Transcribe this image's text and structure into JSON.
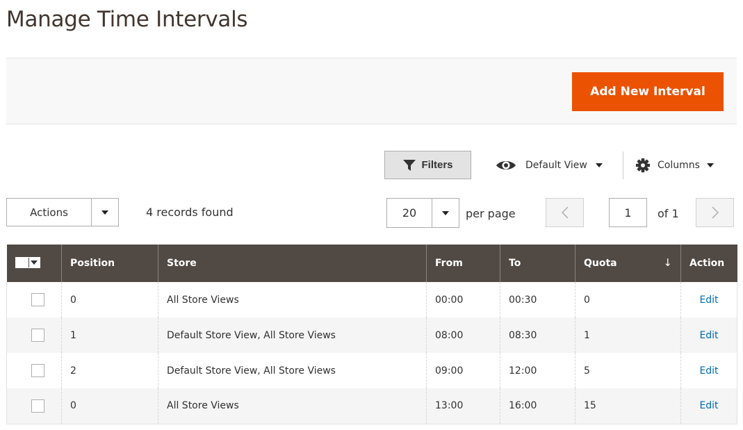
{
  "page": {
    "title": "Manage Time Intervals"
  },
  "actions": {
    "add_label": "Add New Interval"
  },
  "toolbar": {
    "filters_label": "Filters",
    "view_label": "Default View",
    "columns_label": "Columns",
    "mass_actions_label": "Actions",
    "records_found": "4 records found",
    "per_page_value": "20",
    "per_page_label": "per page",
    "page_value": "1",
    "page_of": "of 1"
  },
  "table": {
    "headers": {
      "position": "Position",
      "store": "Store",
      "from": "From",
      "to": "To",
      "quota": "Quota",
      "action": "Action"
    },
    "sorted_column": "quota",
    "sort_indicator": "↓",
    "rows": [
      {
        "position": "0",
        "store": "All Store Views",
        "from": "00:00",
        "to": "00:30",
        "quota": "0",
        "action": "Edit"
      },
      {
        "position": "1",
        "store": "Default Store View, All Store Views",
        "from": "08:00",
        "to": "08:30",
        "quota": "1",
        "action": "Edit"
      },
      {
        "position": "2",
        "store": "Default Store View, All Store Views",
        "from": "09:00",
        "to": "12:00",
        "quota": "5",
        "action": "Edit"
      },
      {
        "position": "0",
        "store": "All Store Views",
        "from": "13:00",
        "to": "16:00",
        "quota": "15",
        "action": "Edit"
      }
    ]
  },
  "colors": {
    "accent": "#eb5202",
    "header_bg": "#514943",
    "link": "#006bb4"
  },
  "icons": {
    "filters": "funnel-icon",
    "view": "eye-icon",
    "columns": "gear-icon",
    "prev": "chevron-left-icon",
    "next": "chevron-right-icon"
  }
}
